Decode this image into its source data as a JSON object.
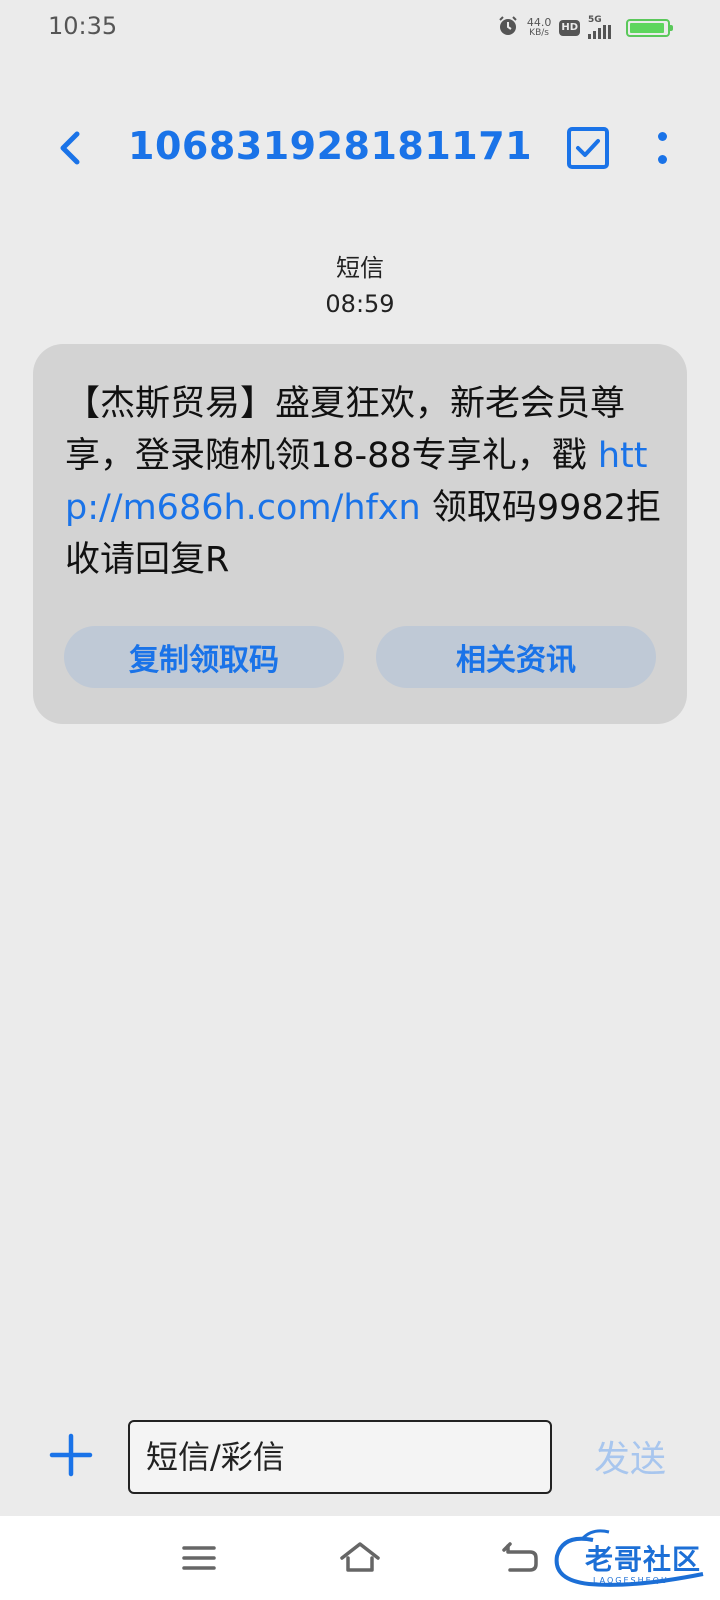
{
  "status_bar": {
    "time": "10:35",
    "net_speed_value": "44.0",
    "net_speed_unit": "KB/s",
    "hd_label": "HD",
    "network_label": "5G",
    "battery_level": 0.95
  },
  "header": {
    "contact": "106831928181171",
    "icons": [
      "back-icon",
      "select-checkbox-icon",
      "more-vert-icon"
    ]
  },
  "message": {
    "type_label": "短信",
    "time": "08:59",
    "text_before_link": "【杰斯贸易】盛夏狂欢，新老会员尊享，登录随机领18-88专享礼，戳 ",
    "link": "http://m686h.com/hfxn",
    "text_after_link": " 领取码9982拒收请回复R",
    "actions": [
      "复制领取码",
      "相关资讯"
    ]
  },
  "composer": {
    "placeholder": "短信/彩信",
    "send_label": "发送"
  },
  "watermark": {
    "text": "老哥社区",
    "sub": "LAOGESHEQU"
  },
  "colors": {
    "accent": "#1a73e8",
    "background": "#ebebeb",
    "bubble": "#d3d3d3",
    "action_button": "#bfc9d6",
    "send_disabled": "#a8c6ee"
  }
}
